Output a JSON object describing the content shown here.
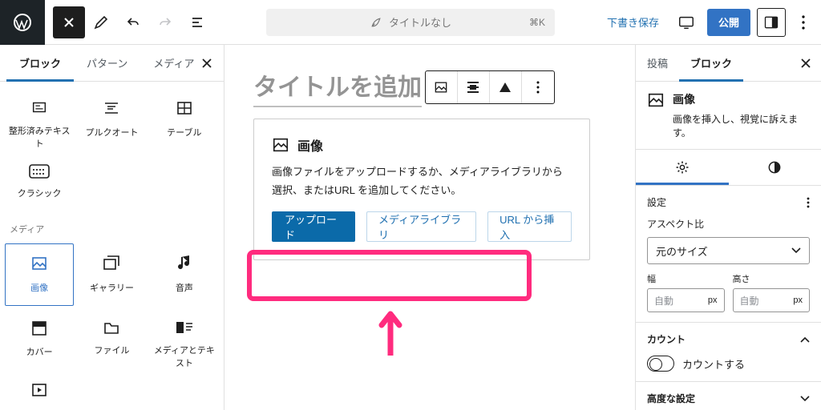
{
  "topbar": {
    "title": "タイトルなし",
    "shortcut": "⌘K",
    "save_draft": "下書き保存",
    "publish": "公開"
  },
  "inserter": {
    "tabs": {
      "blocks": "ブロック",
      "patterns": "パターン",
      "media": "メディア"
    },
    "text_blocks": {
      "preformatted": "整形済みテキスト",
      "pullquote": "プルクオート",
      "table": "テーブル",
      "classic": "クラシック"
    },
    "media_section_label": "メディア",
    "media_blocks": {
      "image": "画像",
      "gallery": "ギャラリー",
      "audio": "音声",
      "cover": "カバー",
      "file": "ファイル",
      "media_text": "メディアとテキスト"
    }
  },
  "editor": {
    "post_title_placeholder": "タイトルを追加",
    "image_block": {
      "heading": "画像",
      "description": "画像ファイルをアップロードするか、メディアライブラリから選択、またはURL を追加してください。",
      "upload_label": "アップロード",
      "media_library_label": "メディアライブラリ",
      "from_url_label": "URL から挿入"
    }
  },
  "settings": {
    "tab_post": "投稿",
    "tab_block": "ブロック",
    "block_name": "画像",
    "block_hint": "画像を挿入し、視覚に訴えます。",
    "section_settings": "設定",
    "aspect_ratio_label": "アスペクト比",
    "aspect_ratio_value": "元のサイズ",
    "width_label": "幅",
    "height_label": "高さ",
    "auto_placeholder": "自動",
    "unit_px": "px",
    "section_count": "カウント",
    "count_toggle_label": "カウントする",
    "section_advanced": "高度な設定"
  }
}
